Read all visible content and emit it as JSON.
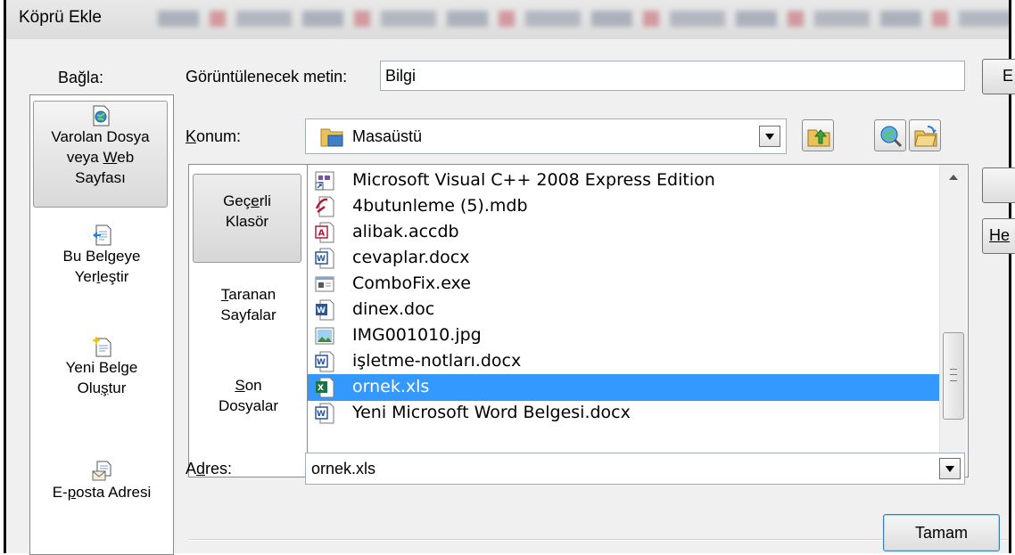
{
  "dialog": {
    "title": "Köprü Ekle"
  },
  "link_to": {
    "label": "Bağla:",
    "items": [
      {
        "line1": "Varolan Dosya",
        "line2_pre": "veya ",
        "line2_u": "W",
        "line2_post": "eb",
        "line3": "Sayfası",
        "icon": "existing-file-globe-icon",
        "selected": true
      },
      {
        "line1": "Bu Belgeye",
        "line2_pre": "Yer",
        "line2_u": "l",
        "line2_post": "eştir",
        "icon": "place-in-document-icon",
        "selected": false
      },
      {
        "line1": "Yeni Belge",
        "line2_pre": "Olu",
        "line2_u": "ş",
        "line2_post": "tur",
        "icon": "new-document-icon",
        "selected": false
      },
      {
        "line1_pre": "E-",
        "line1_u": "p",
        "line1_post": "osta Adresi",
        "icon": "email-address-icon",
        "selected": false
      }
    ]
  },
  "text_to_display": {
    "label": "Görüntülenecek metin:",
    "value": "Bilgi"
  },
  "screentip_button": {
    "label": "E"
  },
  "look_in": {
    "label_u": "K",
    "label_rest": "onum:",
    "value": "Masaüstü",
    "folder_icon": "desktop-folder-icon"
  },
  "toolbar": {
    "up_folder": "up-one-folder-icon",
    "browse_web": "browse-web-icon",
    "browse_file": "browse-file-icon"
  },
  "sources": [
    {
      "line1_pre": "Geç",
      "line1_u": "e",
      "line1_post": "rli",
      "line2": "Klasör",
      "selected": true
    },
    {
      "line1_u": "T",
      "line1_post": "aranan",
      "line2": "Sayfalar",
      "selected": false
    },
    {
      "line1_u": "S",
      "line1_post": "on",
      "line2": "Dosyalar",
      "selected": false
    }
  ],
  "files": [
    {
      "name": "Microsoft Visual C++ 2008 Express Edition",
      "icon": "shortcut-icon",
      "selected": false
    },
    {
      "name": "4butunleme (5).mdb",
      "icon": "access-mdb-icon",
      "selected": false
    },
    {
      "name": "alibak.accdb",
      "icon": "access-accdb-icon",
      "selected": false
    },
    {
      "name": "cevaplar.docx",
      "icon": "word-docx-icon",
      "selected": false
    },
    {
      "name": "ComboFix.exe",
      "icon": "exe-application-icon",
      "selected": false
    },
    {
      "name": "dinex.doc",
      "icon": "word-doc-icon",
      "selected": false
    },
    {
      "name": "IMG001010.jpg",
      "icon": "image-jpg-icon",
      "selected": false
    },
    {
      "name": "işletme-notları.docx",
      "icon": "word-docx-icon",
      "selected": false
    },
    {
      "name": "ornek.xls",
      "icon": "excel-xls-icon",
      "selected": true
    },
    {
      "name": "Yeni Microsoft Word Belgesi.docx",
      "icon": "word-docx-icon",
      "selected": false
    }
  ],
  "right_buttons": {
    "b1": "",
    "b2": "He"
  },
  "address": {
    "label_pre": "A",
    "label_u": "d",
    "label_post": "res:",
    "value": "ornek.xls"
  },
  "ok_button": {
    "label": "Tamam"
  },
  "colors": {
    "selection": "#3399ff",
    "dialog_bg": "#f0f0f0"
  }
}
